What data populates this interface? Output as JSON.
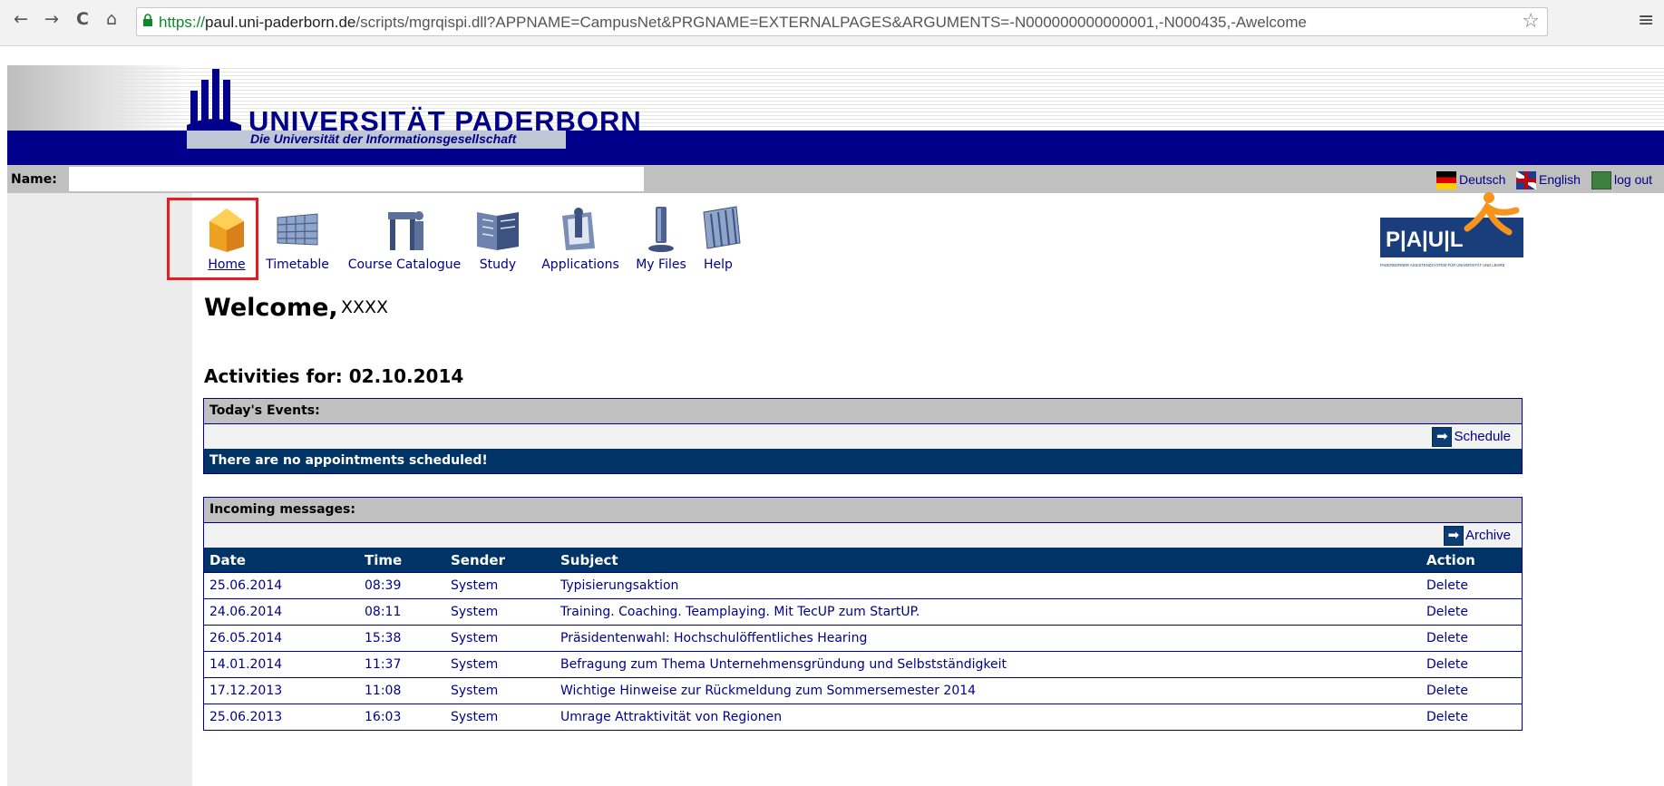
{
  "browser": {
    "url_scheme": "https://",
    "url_domain": "paul.uni-paderborn.de",
    "url_path": "/scripts/mgrqispi.dll?APPNAME=CampusNet&PRGNAME=EXTERNALPAGES&ARGUMENTS=-N000000000000001,-N000435,-Awelcome",
    "back_glyph": "←",
    "forward_glyph": "→",
    "reload_glyph": "C",
    "home_glyph": "⌂",
    "star_glyph": "☆",
    "menu_glyph": "≡"
  },
  "header": {
    "university_name": "UNIVERSITÄT PADERBORN",
    "tagline": "Die Universität der Informationsgesellschaft"
  },
  "name_bar": {
    "label": "Name:",
    "languages": [
      {
        "label": "Deutsch",
        "icon": "german-flag-icon"
      },
      {
        "label": "English",
        "icon": "uk-flag-icon"
      },
      {
        "label": "log out",
        "icon": "logout-icon"
      }
    ]
  },
  "nav": {
    "items": [
      {
        "label": "Home",
        "icon": "home-icon",
        "active": true
      },
      {
        "label": "Timetable",
        "icon": "timetable-icon"
      },
      {
        "label": "Course Catalogue",
        "icon": "course-catalogue-icon"
      },
      {
        "label": "Study",
        "icon": "study-icon"
      },
      {
        "label": "Applications",
        "icon": "applications-icon"
      },
      {
        "label": "My Files",
        "icon": "my-files-icon"
      },
      {
        "label": "Help",
        "icon": "help-icon"
      }
    ]
  },
  "paul_logo": {
    "letters": "P|A|U|L",
    "caption": "PADERBORNER ASSISTENZSYSTEM FÜR UNIVERSITÄT UND LEHRE"
  },
  "welcome": {
    "greeting": "Welcome,",
    "user": "XXXX"
  },
  "activities": {
    "title": "Activities for: 02.10.2014"
  },
  "events": {
    "header": "Today's Events:",
    "schedule_label": "Schedule",
    "empty_message": "There are no appointments scheduled!"
  },
  "messages": {
    "header": "Incoming messages:",
    "archive_label": "Archive",
    "columns": [
      "Date",
      "Time",
      "Sender",
      "Subject",
      "Action"
    ],
    "rows": [
      {
        "date": "25.06.2014",
        "time": "08:39",
        "sender": "System",
        "subject": "Typisierungsaktion",
        "action": "Delete"
      },
      {
        "date": "24.06.2014",
        "time": "08:11",
        "sender": "System",
        "subject": "Training. Coaching. Teamplaying. Mit TecUP zum StartUP.",
        "action": "Delete"
      },
      {
        "date": "26.05.2014",
        "time": "15:38",
        "sender": "System",
        "subject": "Präsidentenwahl: Hochschulöffentliches Hearing",
        "action": "Delete"
      },
      {
        "date": "14.01.2014",
        "time": "11:37",
        "sender": "System",
        "subject": "Befragung zum Thema Unternehmensgründung und Selbstständigkeit",
        "action": "Delete"
      },
      {
        "date": "17.12.2013",
        "time": "11:08",
        "sender": "System",
        "subject": "Wichtige Hinweise zur Rückmeldung zum Sommersemester 2014",
        "action": "Delete"
      },
      {
        "date": "25.06.2013",
        "time": "16:03",
        "sender": "System",
        "subject": "Umrage Attraktivität von Regionen",
        "action": "Delete"
      }
    ]
  },
  "colors": {
    "brand_blue": "#00008b",
    "dark_row": "#003366",
    "highlight": "#e02020",
    "paul_orange": "#f7941d"
  }
}
